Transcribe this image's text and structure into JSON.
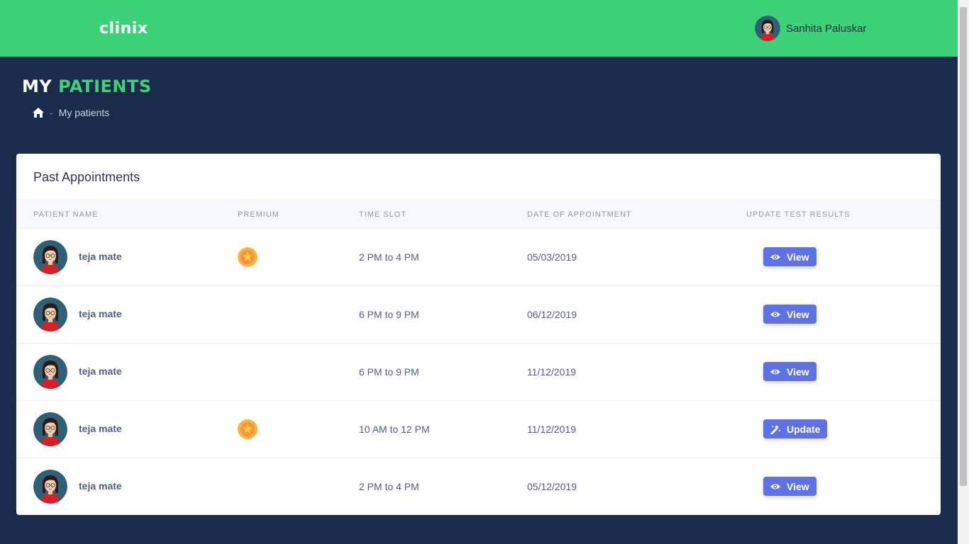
{
  "header": {
    "logo": "clinix",
    "user_name": "Sanhita Paluskar"
  },
  "page": {
    "title_part1": "MY",
    "title_part2": "PATIENTS",
    "breadcrumb_sep": "-",
    "breadcrumb_current": "My patients"
  },
  "card": {
    "title": "Past Appointments",
    "columns": [
      "PATIENT NAME",
      "PREMIUM",
      "TIME SLOT",
      "DATE OF APPOINTMENT",
      "UPDATE TEST RESULTS"
    ],
    "rows": [
      {
        "name": "teja mate",
        "premium": true,
        "slot": "2 PM to 4 PM",
        "date": "05/03/2019",
        "action": "View",
        "action_icon": "eye-icon"
      },
      {
        "name": "teja mate",
        "premium": false,
        "slot": "6 PM to 9 PM",
        "date": "06/12/2019",
        "action": "View",
        "action_icon": "eye-icon"
      },
      {
        "name": "teja mate",
        "premium": false,
        "slot": "6 PM to 9 PM",
        "date": "11/12/2019",
        "action": "View",
        "action_icon": "eye-icon"
      },
      {
        "name": "teja mate",
        "premium": true,
        "slot": "10 AM to 12 PM",
        "date": "11/12/2019",
        "action": "Update",
        "action_icon": "magic-wand-icon"
      },
      {
        "name": "teja mate",
        "premium": false,
        "slot": "2 PM to 4 PM",
        "date": "05/12/2019",
        "action": "View",
        "action_icon": "eye-icon"
      }
    ]
  },
  "colors": {
    "header_green": "#3dd27a",
    "background_navy": "#1a2b4c",
    "button_indigo": "#5e72e4"
  }
}
